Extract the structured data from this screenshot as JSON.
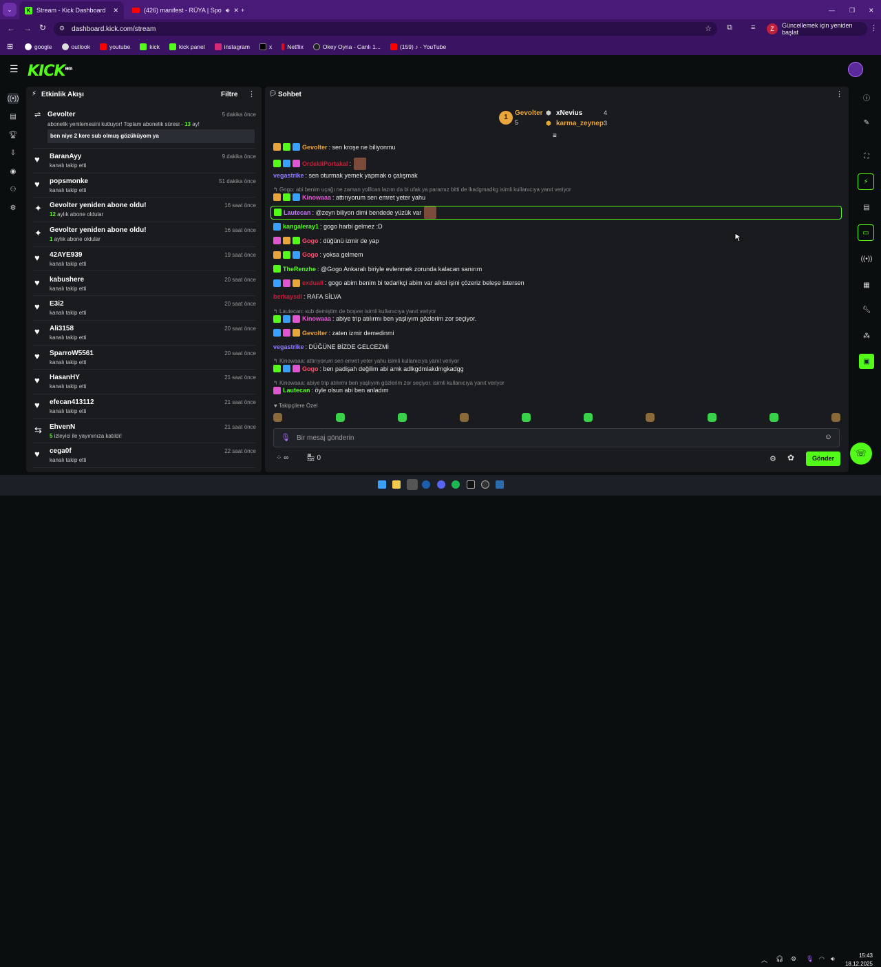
{
  "browser": {
    "tabs": [
      {
        "title": "Stream - Kick Dashboard",
        "active": true
      },
      {
        "title": "(426) manifest - RÜYA | Spo",
        "active": false
      }
    ],
    "url": "dashboard.kick.com/stream",
    "update_button": "Güncellemek için yeniden başlat",
    "profile_letter": "Z",
    "bookmarks": [
      "google",
      "outlook",
      "youtube",
      "kick",
      "kick panel",
      "instagram",
      "x",
      "Netflix",
      "Okey Oyna - Canlı 1...",
      "(159) ♪ - YouTube"
    ]
  },
  "kick": {
    "logo": "KICK",
    "logo_beta": "BETA"
  },
  "activity": {
    "title": "Etkinlik Akışı",
    "filter_label": "Filtre",
    "items": [
      {
        "name": "Gevolter",
        "time": "5 dakika önce",
        "icon": "renew-icon",
        "sub_prefix": "abonelik yenilemesini kutluyor! Toplam abonelik süresi - ",
        "sub_value": "13",
        "sub_suffix": " ay!",
        "quote": "ben niye 2 kere sub olmuş gözüküyom ya"
      },
      {
        "name": "BaranAyy",
        "time": "9 dakika önce",
        "icon": "heart-icon",
        "sub": "kanalı takip etti"
      },
      {
        "name": "popsmonke",
        "time": "51 dakika önce",
        "icon": "heart-icon",
        "sub": "kanalı takip etti"
      },
      {
        "name": "Gevolter yeniden abone oldu!",
        "time": "16 saat önce",
        "icon": "sparkle-icon",
        "sub_value": "12",
        "sub_suffix": " aylık abone oldular"
      },
      {
        "name": "Gevolter yeniden abone oldu!",
        "time": "16 saat önce",
        "icon": "sparkle-icon",
        "sub_value": "1",
        "sub_suffix": " aylık abone oldular"
      },
      {
        "name": "42AYE939",
        "time": "19 saat önce",
        "icon": "heart-icon",
        "sub": "kanalı takip etti"
      },
      {
        "name": "kabushere",
        "time": "20 saat önce",
        "icon": "heart-icon",
        "sub": "kanalı takip etti"
      },
      {
        "name": "E3i2",
        "time": "20 saat önce",
        "icon": "heart-icon",
        "sub": "kanalı takip etti"
      },
      {
        "name": "Ali3158",
        "time": "20 saat önce",
        "icon": "heart-icon",
        "sub": "kanalı takip etti"
      },
      {
        "name": "SparroW5561",
        "time": "20 saat önce",
        "icon": "heart-icon",
        "sub": "kanalı takip etti"
      },
      {
        "name": "HasanHY",
        "time": "21 saat önce",
        "icon": "heart-icon",
        "sub": "kanalı takip etti"
      },
      {
        "name": "efecan413112",
        "time": "21 saat önce",
        "icon": "heart-icon",
        "sub": "kanalı takip etti"
      },
      {
        "name": "EhvenN",
        "time": "21 saat önce",
        "icon": "host-icon",
        "sub_value": "5",
        "sub_suffix": " izleyici ile yayınınıza katıldı!"
      },
      {
        "name": "cega0f",
        "time": "22 saat önce",
        "icon": "heart-icon",
        "sub": "kanalı takip etti"
      }
    ]
  },
  "chat": {
    "title": "Sohbet",
    "leaderboard": {
      "first": {
        "name": "Gevolter",
        "rank": "1",
        "count": "5"
      },
      "second": {
        "name": "xNevius",
        "count": "4"
      },
      "third": {
        "name": "karma_zeynep",
        "count": "3"
      }
    },
    "messages": [
      {
        "user": "Gevolter",
        "color": "#e8a53a",
        "text": ": sen kroşe ne biliyonmu"
      },
      {
        "user": "OrdekliPortakal",
        "color": "#c0213a",
        "text": ":"
      },
      {
        "user": "vegastrike",
        "color": "#8f7bff",
        "text": ": sen oturmak yemek yapmak o çalışmak"
      },
      {
        "reply": "Gogo: abi benim uçağı ne zaman yolllcan lazım da bi ufak ya paramız bitti de lkadgmadkg isimli kullanıcıya yanıt veriyor"
      },
      {
        "user": "Kinowaaa",
        "color": "#e056d0",
        "text": ": attırıyorum sen emret yeter yahu"
      },
      {
        "user": "Lautecan",
        "color": "#c77dff",
        "text": ": @zeyn biliyon dimi bendede yüzük var"
      },
      {
        "user": "kangaleray1",
        "color": "#53fc18",
        "text": ": gogo harbi gelmez :D"
      },
      {
        "user": "Gogo",
        "color": "#ff4d6d",
        "text": ": düğünü izmir de yap"
      },
      {
        "user": "Gogo",
        "color": "#ff4d6d",
        "text": ": yoksa gelmem"
      },
      {
        "user": "TheRenzhe",
        "color": "#53fc18",
        "text": ": @Gogo Ankaralı biriyle evlenmek zorunda kalacan sanırım"
      },
      {
        "user": "exduall",
        "color": "#c0213a",
        "text": ": gogo abim benim bi tedarikçi abim var alkol işini çözeriz beleşe istersen"
      },
      {
        "user": "berkaysdl",
        "color": "#c0213a",
        "text": ": RAFA SİLVA"
      },
      {
        "reply": "Lautecan: sub demiştim de boşver isimli kullanıcıya yanıt veriyor"
      },
      {
        "user": "Kinowaaa",
        "color": "#e056d0",
        "text": ": abiye trip atılırmı ben yaşlıyım gözlerim zor seçiyor."
      },
      {
        "user": "Gevolter",
        "color": "#e8a53a",
        "text": ": zaten izmir demedinmi"
      },
      {
        "user": "vegastrike",
        "color": "#8f7bff",
        "text": ": DÜĞÜNE BİZDE GELCEZMİ"
      },
      {
        "reply": "Kinowaaa: attırıyorum sen emret yeter yahu isimli kullanıcıya yanıt veriyor"
      },
      {
        "user": "Gogo",
        "color": "#ff4d6d",
        "text": ": ben padişah değilim abi amk adlkgdmlakdmgkadgg"
      },
      {
        "reply": "Kinowaaa: abiye trip atılırmı ben yaşlıyım gözlerim zor seçiyor. isimli kullanıcıya yanıt veriyor"
      },
      {
        "user": "Lautecan",
        "color": "#53fc18",
        "text": ": öyle olsun abi ben anladım"
      }
    ],
    "followers_only_label": "Takipçilere Özel",
    "input_placeholder": "Bir mesaj gönderin",
    "points": "∞",
    "store_count": "0",
    "send_label": "Gönder"
  },
  "taskbar": {
    "time": "15:43",
    "date": "18.12.2025"
  },
  "colors": {
    "accent": "#53fc18",
    "panel": "#191b1f",
    "tabbar": "#4a1a78"
  }
}
